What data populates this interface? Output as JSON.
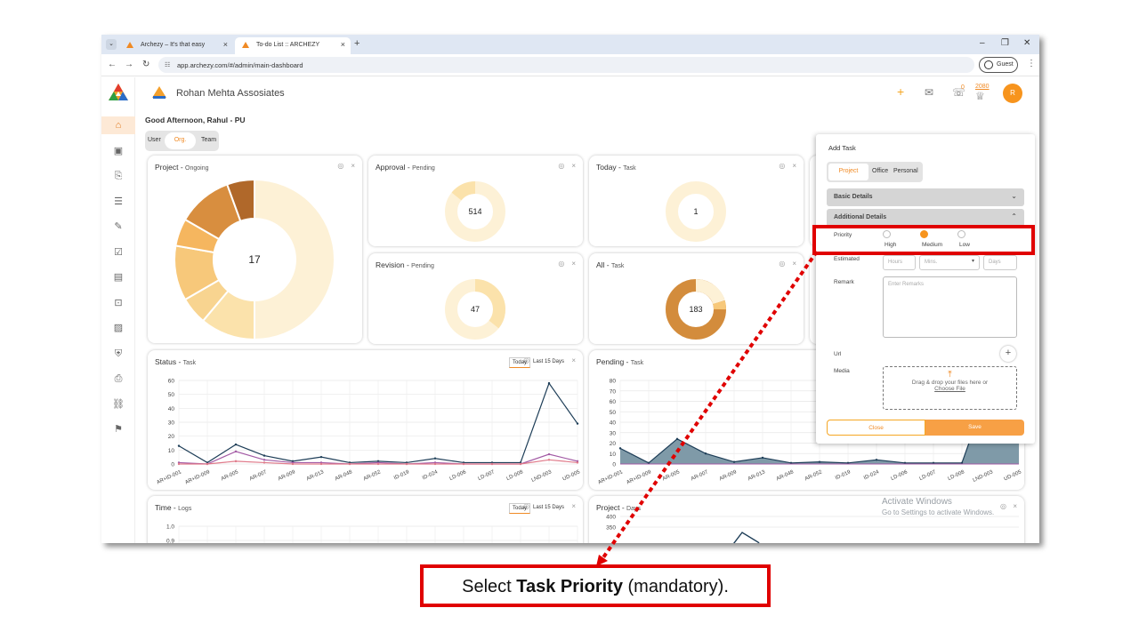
{
  "browser": {
    "tabs": [
      {
        "title": "Archezy – It's that easy"
      },
      {
        "title": "To-do List :: ARCHEZY"
      }
    ],
    "url": "app.archezy.com/#/admin/main-dashboard",
    "profile": "Guest"
  },
  "app": {
    "brand": "ARCHEZY",
    "company": "Rohan Mehta Assosiates",
    "greeting": "Good Afternoon, Rahul - PU",
    "view_toggle": [
      "User",
      "Org.",
      "Team"
    ],
    "header": {
      "notif_count": "0",
      "points": "2080",
      "avatar_initial": "R"
    },
    "sidebar_icons": [
      "home-icon",
      "attendance-icon",
      "clipboard-icon",
      "list-icon",
      "edit-icon",
      "task-icon",
      "book-icon",
      "briefcase-icon",
      "image-icon",
      "shield-icon",
      "report-icon",
      "network-icon",
      "gift-icon"
    ]
  },
  "cards": {
    "project": {
      "title": "Project - ",
      "sub": "Ongoing",
      "center": "17"
    },
    "approval": {
      "title": "Approval - ",
      "sub": "Pending",
      "center": "514"
    },
    "today": {
      "title": "Today - ",
      "sub": "Task",
      "center": "1"
    },
    "revision": {
      "title": "Revision - ",
      "sub": "Pending",
      "center": "47"
    },
    "all": {
      "title": "All - ",
      "sub": "Task",
      "center": "183"
    },
    "status": {
      "title": "Status - ",
      "sub": "Task",
      "chip_today": "Today",
      "chip_15": "Last 15 Days"
    },
    "pending": {
      "title": "Pending - ",
      "sub": "Task"
    },
    "time": {
      "title": "Time - ",
      "sub": "Logs",
      "chip_today": "Today",
      "chip_15": "Last 15 Days"
    },
    "project_days": {
      "title": "Project - ",
      "sub": "Days"
    }
  },
  "chart_data": [
    {
      "type": "pie",
      "title": "Project - Ongoing",
      "center_label": "17",
      "values": [
        9,
        2,
        1,
        2,
        1,
        2,
        1
      ],
      "colors": [
        "#fdf1d6",
        "#fbe2ab",
        "#f8d490",
        "#f7c87a",
        "#f5b65f",
        "#d88e3f",
        "#b0682a"
      ]
    },
    {
      "type": "line",
      "title": "Status - Task",
      "categories": [
        "AR+ID-001",
        "AR+ID-009",
        "AR-005",
        "AR-007",
        "AR-009",
        "AR-013",
        "AR-048",
        "AR-052",
        "ID-019",
        "ID-024",
        "LD-006",
        "LD-007",
        "LD-008",
        "LND-003",
        "UD-005"
      ],
      "ylim": [
        0,
        60
      ],
      "yticks": [
        0,
        10,
        20,
        30,
        40,
        50,
        60
      ],
      "series": [
        {
          "color": "#1d3d57",
          "values": [
            13,
            1,
            14,
            6,
            2,
            5,
            1,
            2,
            1,
            4,
            1,
            1,
            1,
            58,
            29
          ]
        },
        {
          "color": "#a35ba5",
          "values": [
            1,
            0,
            9,
            3,
            1,
            1,
            0,
            1,
            0,
            1,
            0,
            0,
            0,
            7,
            2
          ]
        },
        {
          "color": "#e07a8a",
          "values": [
            0,
            0,
            2,
            1,
            0,
            0,
            0,
            0,
            0,
            0,
            0,
            0,
            0,
            3,
            1
          ]
        }
      ]
    },
    {
      "type": "area",
      "title": "Pending - Task",
      "categories": [
        "AR+ID-001",
        "AR+ID-009",
        "AR-005",
        "AR-007",
        "AR-009",
        "AR-013",
        "AR-048",
        "AR-052",
        "ID-019",
        "ID-024",
        "LD-006",
        "LD-007",
        "LD-008",
        "LND-003",
        "UD-005"
      ],
      "ylim": [
        0,
        80
      ],
      "yticks": [
        0,
        10,
        20,
        30,
        40,
        50,
        60,
        70,
        80
      ],
      "series": [
        {
          "color": "#1d3d57",
          "values": [
            15,
            1,
            24,
            10,
            2,
            6,
            1,
            2,
            1,
            4,
            1,
            1,
            1,
            78,
            80
          ]
        }
      ]
    },
    {
      "type": "line",
      "title": "Time - Logs",
      "ylim": [
        0,
        1.0
      ],
      "yticks": [
        0.9,
        1.0
      ]
    },
    {
      "type": "line",
      "title": "Project - Days",
      "yticks": [
        350,
        400
      ]
    }
  ],
  "panel": {
    "title": "Add Task",
    "tabs": [
      "Project",
      "Office",
      "Personal"
    ],
    "basic_details": "Basic Details",
    "additional_details": "Additional Details",
    "priority_label": "Priority",
    "priority_options": [
      "High",
      "Medium",
      "Low"
    ],
    "priority_selected": "Medium",
    "estimated_label": "Estimated",
    "hours_placeholder": "Hours",
    "mins_placeholder": "Mins.",
    "days_placeholder": "Days",
    "remark_label": "Remark",
    "remark_placeholder": "Enter Remarks",
    "url_label": "Url",
    "media_label": "Media",
    "drop_text": "Drag & drop your files here or",
    "choose_file": "Choose File",
    "close_label": "Close",
    "save_label": "Save"
  },
  "windows_watermark": {
    "line1": "Activate Windows",
    "line2": "Go to Settings to activate Windows."
  },
  "annotation": {
    "prefix": "Select ",
    "bold": "Task Priority",
    "suffix": " (mandatory)."
  }
}
